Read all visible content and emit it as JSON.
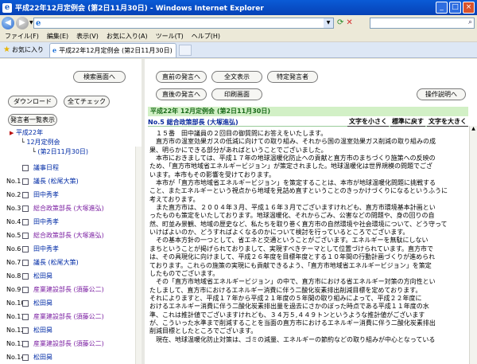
{
  "window": {
    "title": "平成22年12月定例会 (第2日11月30日) - Windows Internet Explorer",
    "min": "_",
    "max": "□",
    "close": "×"
  },
  "menus": [
    "ファイル(F)",
    "編集(E)",
    "表示(V)",
    "お気に入り(A)",
    "ツール(T)",
    "ヘルプ(H)"
  ],
  "favorites": "お気に入り",
  "tab": "平成22年12月定例会 (第2日11月30日)",
  "left": {
    "buttons": {
      "search_screen": "検索画面へ",
      "download": "ダウンロード",
      "check_all": "全てチェック",
      "speakers_list": "発言者一覧表示"
    },
    "tree": [
      "平成22年",
      "12月定例会",
      "(第2日11月30日)"
    ],
    "rows": [
      {
        "no": "",
        "name": "議事日程",
        "style": "blue"
      },
      {
        "no": "No.1",
        "name": "議長 (松尾大策)",
        "style": "blue"
      },
      {
        "no": "No.2",
        "name": "田中秀孝",
        "style": "blue"
      },
      {
        "no": "No.3",
        "name": "総合政策部長 (大塚進弘)",
        "style": "mag"
      },
      {
        "no": "No.4",
        "name": "田中秀孝",
        "style": "blue"
      },
      {
        "no": "No.5",
        "name": "総合政策部長 (大塚進弘)",
        "style": "mag"
      },
      {
        "no": "No.6",
        "name": "田中秀孝",
        "style": "blue"
      },
      {
        "no": "No.7",
        "name": "議長 (松尾大策)",
        "style": "blue"
      },
      {
        "no": "No.8",
        "name": "松田曻",
        "style": "blue"
      },
      {
        "no": "No.9",
        "name": "産業建設部長 (須藤公二)",
        "style": "mag"
      },
      {
        "no": "No.10",
        "name": "松田曻",
        "style": "blue"
      },
      {
        "no": "No.11",
        "name": "産業建設部長 (須藤公二)",
        "style": "mag"
      },
      {
        "no": "No.12",
        "name": "松田曻",
        "style": "blue"
      },
      {
        "no": "No.13",
        "name": "産業建設部長 (須藤公二)",
        "style": "mag"
      },
      {
        "no": "No.14",
        "name": "松田曻",
        "style": "blue"
      }
    ]
  },
  "right": {
    "buttons": {
      "prev_speaker": "直前の発言へ",
      "full_text": "全文表示",
      "specific_speaker": "特定発言者",
      "next_speaker": "直後の発言へ",
      "print_screen": "印刷画面",
      "help": "操作説明へ"
    },
    "session_header": "平成22年 12月定例会 (第2日11月30日)",
    "speaker": "No.5 総合政策部長 (大塚進弘)",
    "font_controls": [
      "文字を小さく",
      "標準に戻す",
      "文字を大きく"
    ],
    "body_lines": [
      "　１５番　田中議員の２回目の御質問にお答えをいたします。",
      "　直方市の温室効果ガスの低減に向けての取り組み、それから国の温室効果ガス削減の取り組みの成",
      "果、明らかにできる部分があればということでございました。",
      "　本市におきましては、平成１７年の地球温暖化防止への貢献と直方市のまちづくり施策への反映の",
      "ため、「直方市地域省エネルギービジョン」が策定されました。地球温暖化は世界規模の問題でござ",
      "います。本市もその影響を受けております。",
      "　本市が「直方市地域省エネルギービジョン」を策定することは、本市が地球温暖化問題に挑戦する",
      "こと、またエネルギーという視点から地域を見詰め直すということのきっかけづくりになるというふうに",
      "考えております。",
      "　また直方市は、２００４年３月、平成１６年３月でございますけれども、直方市環境基本計画とい",
      "ったものも策定をいたしております。地球温暖化、それからごみ、公害などの問題や、身の回りの自",
      "然、町並み景観、地域の歴史など、私たちを取り巻く直方市の自然環境や社会環境について、どう守って",
      "いけばよいのか、どうすればよくなるのかについて検討を行っているところでございます。",
      "　その基本方針の一つとして、省エネと交通ということがございます。エネルギーを無駄にしない",
      "まちということが掲げられておりまして、実現すべきテーマとして位置づけられています。直方市で",
      "は、その具現化に向けまして、平成２６年度を目標年度とする１０年間の行動計画づくりが進められ",
      "ております。これらの施策の実現にも貢献できるよう、「直方市地域省エネルギービジョン」を策定",
      "したものでございます。",
      "　その「直方市地域省エネルギービジョン」の中で、直方市における省エネルギー対策の方向性とい",
      "たしまして、直方市におけるエネルギー消費に伴う二酸化炭素排出削減目標を定めております。",
      "それによりますと、平成１７年から平成２１年度の５年間の取り組みによって、平成２２年度に",
      "おけるエネルギー消費に伴う二酸化炭素排出量を過去にさかのぼった時点である平成１１年度の水",
      "準、これは推計値でございますけれども、３４万５,４４９トンというような推計値がございます",
      "が、こういった水準まで削減することを当面の直方市におけるエネルギー消費に伴う二酸化炭素排出",
      "削減目標としたところでございます。",
      "　現在、地球温暖化防止対策は、ゴミの減量、エネルギーの節約などの取り組みが中心となっている"
    ]
  }
}
